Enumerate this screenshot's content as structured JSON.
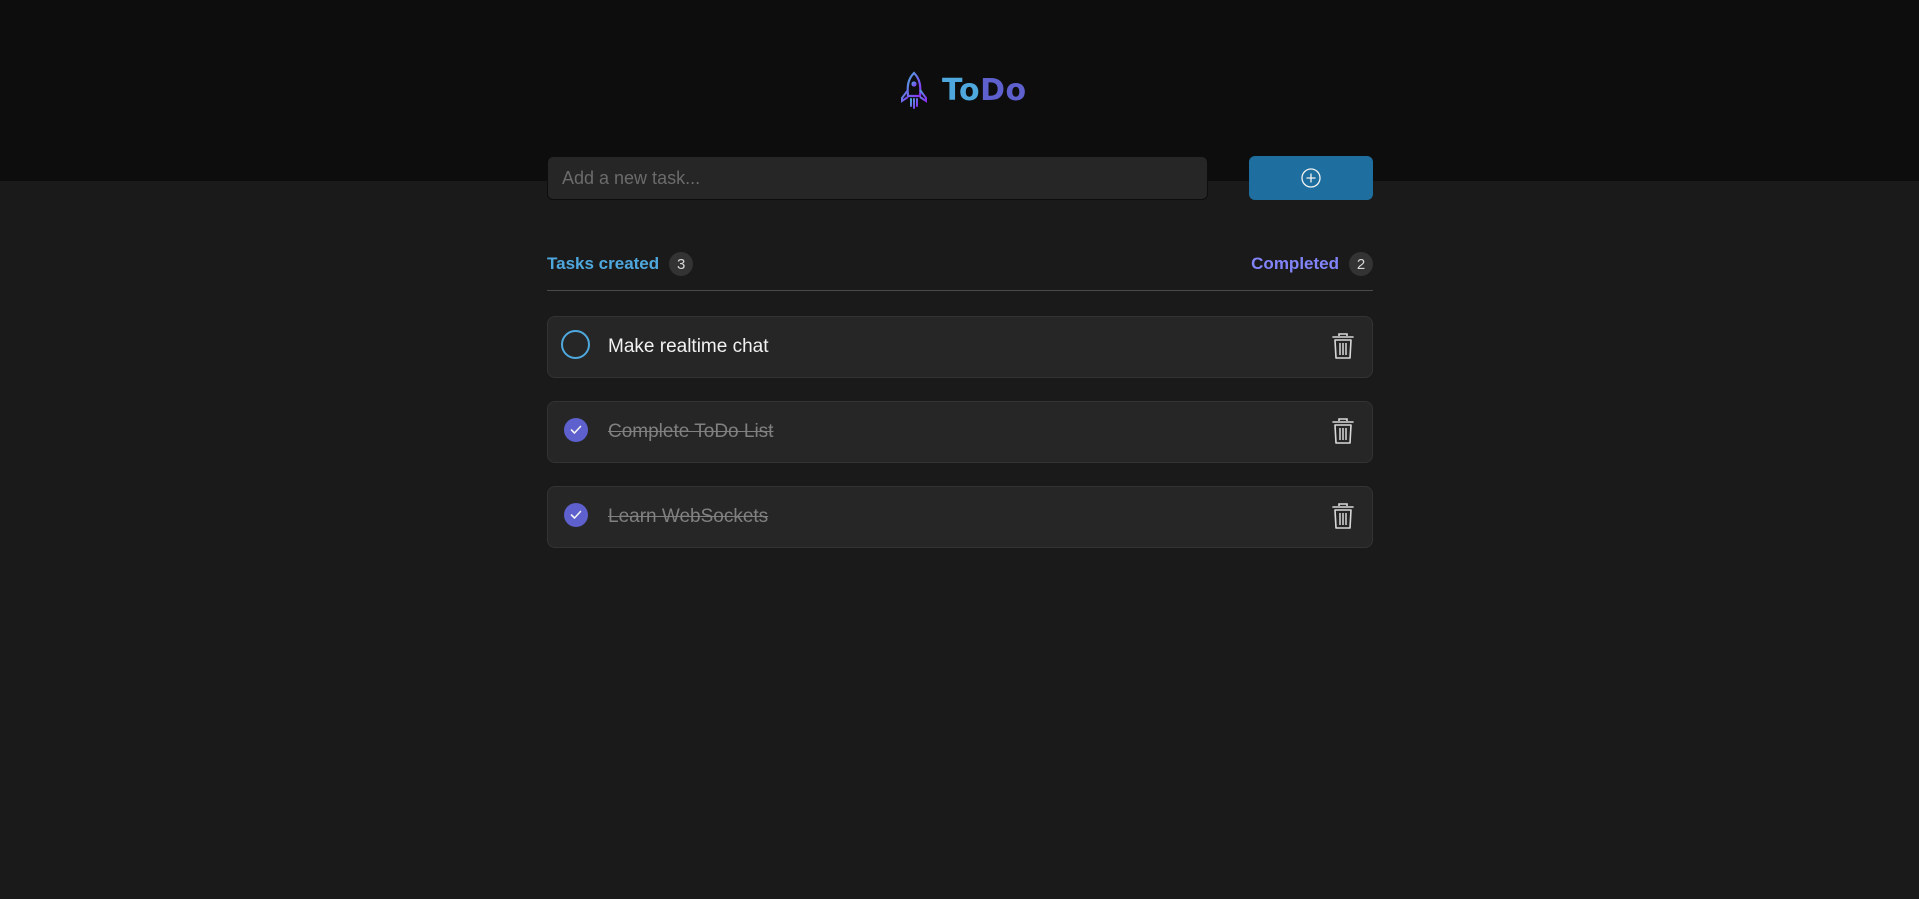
{
  "app": {
    "title_part1": "To",
    "title_part2": "Do",
    "logo_icon": "rocket-icon"
  },
  "new_task": {
    "placeholder": "Add a new task...",
    "value": "",
    "add_button_icon": "plus-circle-icon"
  },
  "stats": {
    "created_label": "Tasks created",
    "created_count": "3",
    "completed_label": "Completed",
    "completed_count": "2"
  },
  "tasks": [
    {
      "text": "Make realtime chat",
      "completed": false
    },
    {
      "text": "Complete ToDo List",
      "completed": true
    },
    {
      "text": "Learn WebSockets",
      "completed": true
    }
  ],
  "colors": {
    "header_bg": "#0d0d0d",
    "page_bg": "#1a1a1a",
    "blue": "#4ea8de",
    "purple": "#5e60ce",
    "purple_light": "#8284fa",
    "button_blue": "#1e6f9f"
  }
}
